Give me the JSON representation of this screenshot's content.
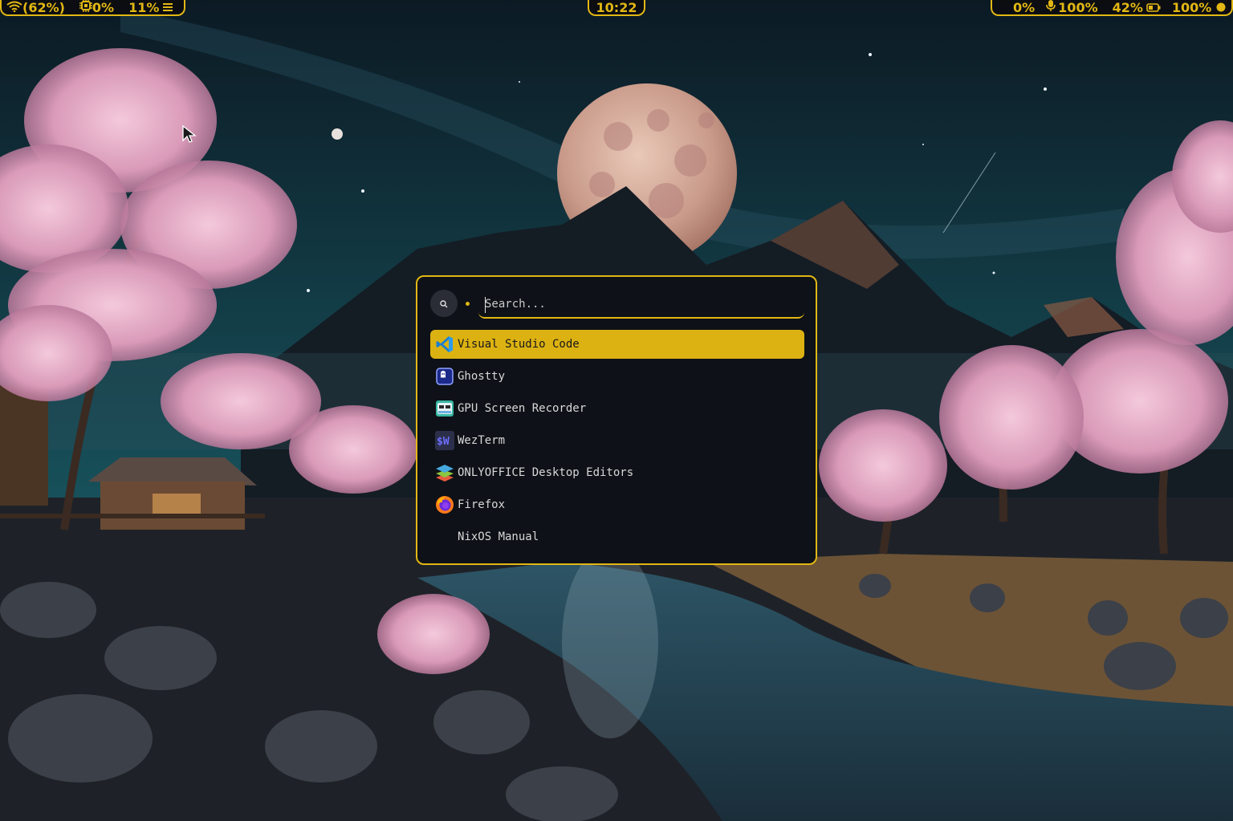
{
  "colors": {
    "accent": "#e2b714",
    "panel": "#0e1117",
    "selected": "#dcb212"
  },
  "topbar": {
    "left": {
      "wifi_icon": "wifi-icon",
      "wifi_label": "(62%)",
      "cpu_icon": "cpu-icon",
      "cpu_label": "0%",
      "mem_label": "11%",
      "menu_icon": "menu-icon"
    },
    "clock": "10:22",
    "right": {
      "volume_label": "0%",
      "mic_icon": "microphone-icon",
      "mic_label": "100%",
      "battery_label": "42%",
      "battery_icon": "battery-icon",
      "brightness_label": "100%",
      "brightness_icon": "brightness-icon"
    }
  },
  "launcher": {
    "search_icon": "search-icon",
    "search_placeholder": "Search...",
    "apps": [
      {
        "label": "Visual Studio Code",
        "icon": "vscode-icon",
        "selected": true
      },
      {
        "label": "Ghostty",
        "icon": "ghostty-icon"
      },
      {
        "label": "GPU Screen Recorder",
        "icon": "gpu-screen-recorder-icon"
      },
      {
        "label": "WezTerm",
        "icon": "wezterm-icon"
      },
      {
        "label": "ONLYOFFICE Desktop Editors",
        "icon": "onlyoffice-icon"
      },
      {
        "label": "Firefox",
        "icon": "firefox-icon"
      },
      {
        "label": "NixOS Manual",
        "icon": ""
      }
    ]
  }
}
